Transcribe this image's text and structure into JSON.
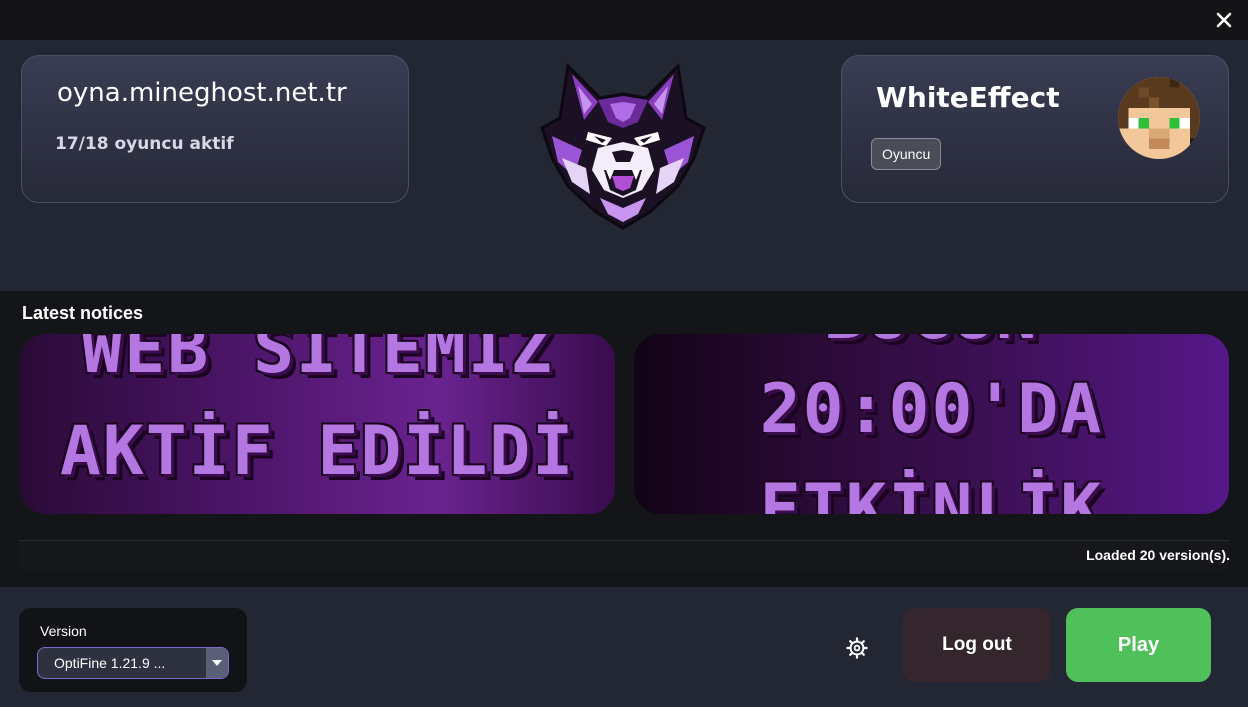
{
  "window": {
    "close_icon": "close-icon"
  },
  "server": {
    "address": "oyna.mineghost.net.tr",
    "players": "17/18 oyuncu aktif"
  },
  "logo": {
    "icon": "wolf-logo"
  },
  "user": {
    "name": "WhiteEffect",
    "role": "Oyuncu",
    "avatar_icon": "player-skin-avatar"
  },
  "notices": {
    "title": "Latest notices",
    "items": [
      {
        "lines": [
          "WEB SİTEMİZ",
          "AKTİF EDİLDİ"
        ]
      },
      {
        "lines": [
          "BUGÜN",
          "20:00'DA",
          "ETKİNLİK"
        ]
      }
    ],
    "status": "Loaded 20 version(s)."
  },
  "footer": {
    "version_label": "Version",
    "version_value": "OptiFine 1.21.9 ...",
    "settings_icon": "gear-icon",
    "logout_label": "Log out",
    "play_label": "Play"
  },
  "colors": {
    "accent": "#7a6acb",
    "play": "#4fc05a",
    "logout": "#35262e",
    "banner_text": "#b476e0"
  }
}
